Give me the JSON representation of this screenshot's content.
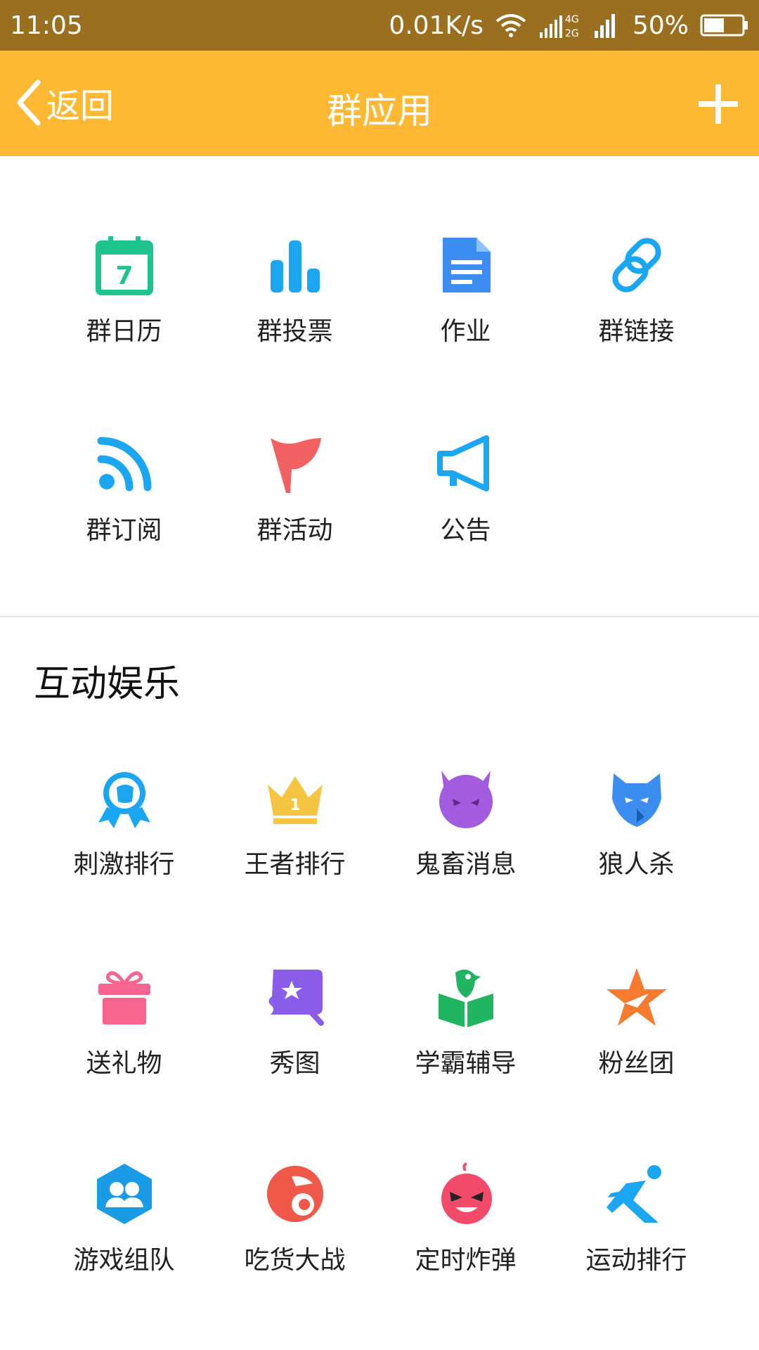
{
  "status_bar": {
    "time": "11:05",
    "speed": "0.01K/s",
    "network_types": "4G\n2G",
    "battery": "50%"
  },
  "header": {
    "back_label": "返回",
    "title": "群应用"
  },
  "apps": [
    {
      "label": "群日历",
      "icon": "calendar-icon"
    },
    {
      "label": "群投票",
      "icon": "bar-chart-icon"
    },
    {
      "label": "作业",
      "icon": "document-icon"
    },
    {
      "label": "群链接",
      "icon": "link-icon"
    },
    {
      "label": "群订阅",
      "icon": "rss-icon"
    },
    {
      "label": "群活动",
      "icon": "flag-icon"
    },
    {
      "label": "公告",
      "icon": "megaphone-icon"
    }
  ],
  "entertainment": {
    "title": "互动娱乐",
    "items": [
      {
        "label": "刺激排行",
        "icon": "medal-icon"
      },
      {
        "label": "王者排行",
        "icon": "crown-icon"
      },
      {
        "label": "鬼畜消息",
        "icon": "devil-icon"
      },
      {
        "label": "狼人杀",
        "icon": "wolf-icon"
      },
      {
        "label": "送礼物",
        "icon": "gift-icon"
      },
      {
        "label": "秀图",
        "icon": "magic-picture-icon"
      },
      {
        "label": "学霸辅导",
        "icon": "book-parrot-icon"
      },
      {
        "label": "粉丝团",
        "icon": "star-icon"
      },
      {
        "label": "游戏组队",
        "icon": "team-hexagon-icon"
      },
      {
        "label": "吃货大战",
        "icon": "foodie-icon"
      },
      {
        "label": "定时炸弹",
        "icon": "bomb-icon"
      },
      {
        "label": "运动排行",
        "icon": "runner-icon"
      }
    ]
  },
  "colors": {
    "status_bar": "#9a7020",
    "header": "#fdb933",
    "calendar": "#1fc38e",
    "blue": "#1ba6f2",
    "doc_blue": "#3b8ef0",
    "red": "#f26161",
    "purple": "#a35be0",
    "pink": "#f7658e"
  }
}
